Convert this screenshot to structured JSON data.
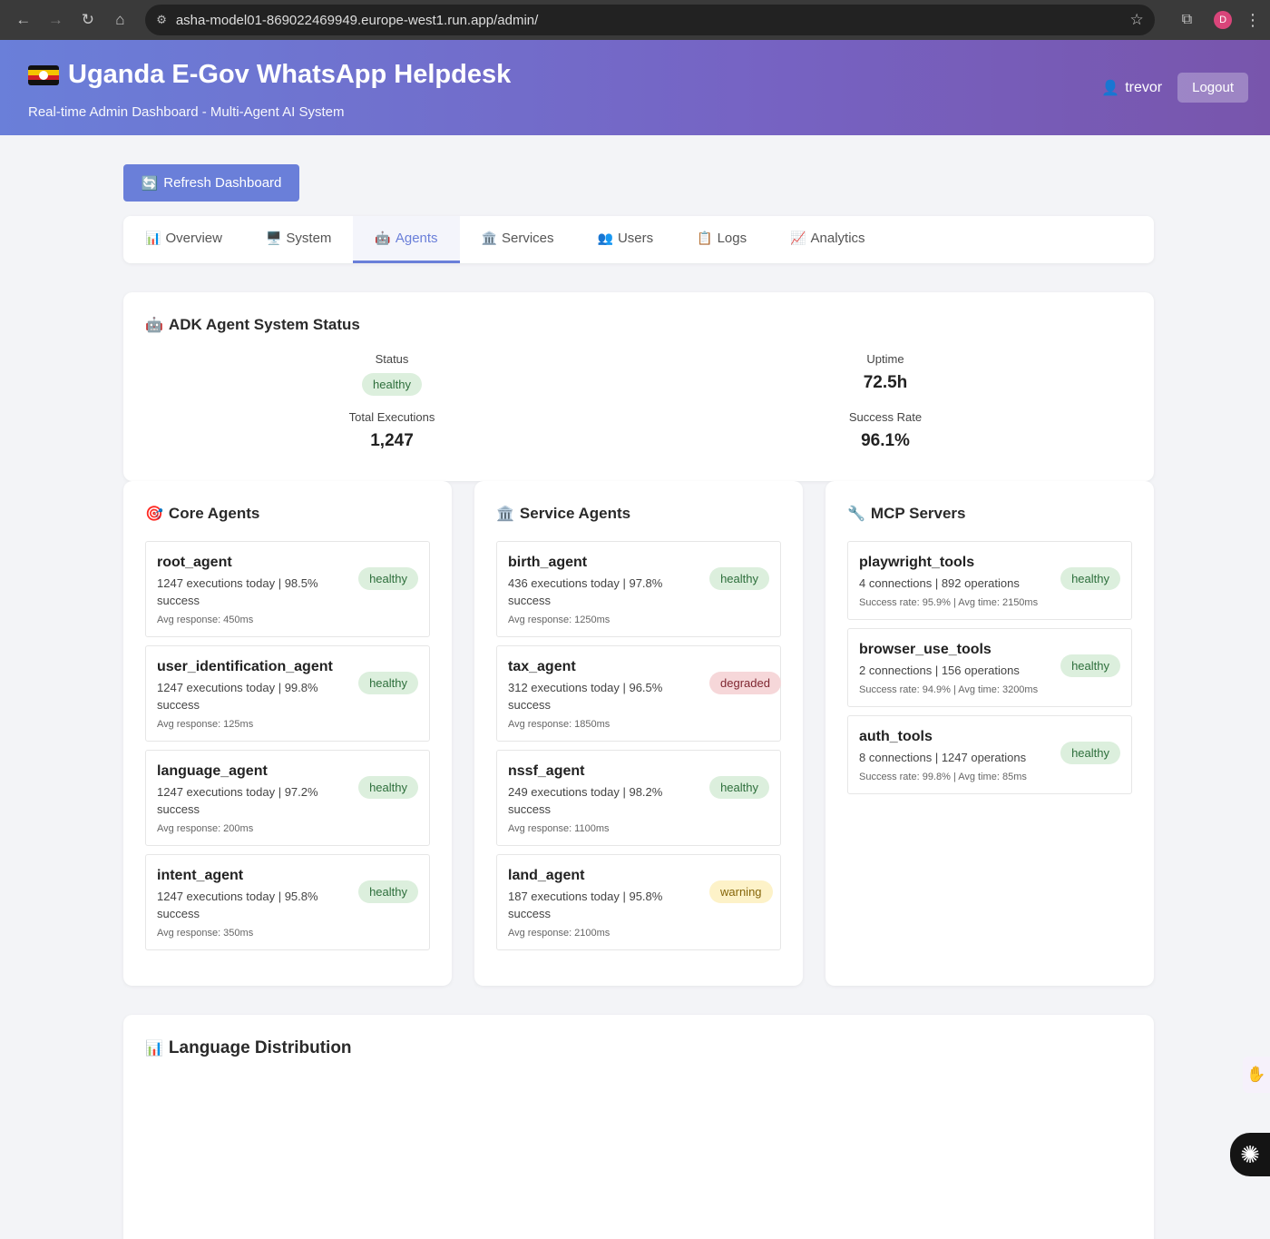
{
  "browser": {
    "url": "asha-model01-869022469949.europe-west1.run.app/admin/",
    "profile_initial": "D"
  },
  "header": {
    "title": "Uganda E-Gov WhatsApp Helpdesk",
    "subtitle": "Real-time Admin Dashboard - Multi-Agent AI System",
    "username": "trevor",
    "logout_label": "Logout"
  },
  "toolbar": {
    "refresh_label": "Refresh Dashboard"
  },
  "tabs": [
    {
      "label": "Overview",
      "icon": "📊"
    },
    {
      "label": "System",
      "icon": "🖥️"
    },
    {
      "label": "Agents",
      "icon": "🤖"
    },
    {
      "label": "Services",
      "icon": "🏛️"
    },
    {
      "label": "Users",
      "icon": "👥"
    },
    {
      "label": "Logs",
      "icon": "📋"
    },
    {
      "label": "Analytics",
      "icon": "📈"
    }
  ],
  "active_tab": "Agents",
  "system_status": {
    "title": "ADK Agent System Status",
    "status_label": "Status",
    "status_value": "healthy",
    "uptime_label": "Uptime",
    "uptime_value": "72.5h",
    "executions_label": "Total Executions",
    "executions_value": "1,247",
    "success_label": "Success Rate",
    "success_value": "96.1%"
  },
  "core_agents": {
    "title": "Core Agents",
    "items": [
      {
        "name": "root_agent",
        "desc": "1247 executions today | 98.5% success",
        "sub": "Avg response: 450ms",
        "status": "healthy"
      },
      {
        "name": "user_identification_agent",
        "desc": "1247 executions today | 99.8% success",
        "sub": "Avg response: 125ms",
        "status": "healthy"
      },
      {
        "name": "language_agent",
        "desc": "1247 executions today | 97.2% success",
        "sub": "Avg response: 200ms",
        "status": "healthy"
      },
      {
        "name": "intent_agent",
        "desc": "1247 executions today | 95.8% success",
        "sub": "Avg response: 350ms",
        "status": "healthy"
      }
    ]
  },
  "service_agents": {
    "title": "Service Agents",
    "items": [
      {
        "name": "birth_agent",
        "desc": "436 executions today | 97.8% success",
        "sub": "Avg response: 1250ms",
        "status": "healthy"
      },
      {
        "name": "tax_agent",
        "desc": "312 executions today | 96.5% success",
        "sub": "Avg response: 1850ms",
        "status": "degraded"
      },
      {
        "name": "nssf_agent",
        "desc": "249 executions today | 98.2% success",
        "sub": "Avg response: 1100ms",
        "status": "healthy"
      },
      {
        "name": "land_agent",
        "desc": "187 executions today | 95.8% success",
        "sub": "Avg response: 2100ms",
        "status": "warning"
      }
    ]
  },
  "mcp_servers": {
    "title": "MCP Servers",
    "items": [
      {
        "name": "playwright_tools",
        "desc": "4 connections | 892 operations",
        "sub": "Success rate: 95.9% | Avg time: 2150ms",
        "status": "healthy"
      },
      {
        "name": "browser_use_tools",
        "desc": "2 connections | 156 operations",
        "sub": "Success rate: 94.9% | Avg time: 3200ms",
        "status": "healthy"
      },
      {
        "name": "auth_tools",
        "desc": "8 connections | 1247 operations",
        "sub": "Success rate: 99.8% | Avg time: 85ms",
        "status": "healthy"
      }
    ]
  },
  "language_distribution": {
    "title": "Language Distribution"
  },
  "colors": {
    "accent": "#6a7fd9",
    "header_gradient_start": "#6a7fd9",
    "header_gradient_end": "#7855ac",
    "healthy": "#dcefdd",
    "degraded": "#f6d7d9",
    "warning": "#fdf2c8"
  }
}
